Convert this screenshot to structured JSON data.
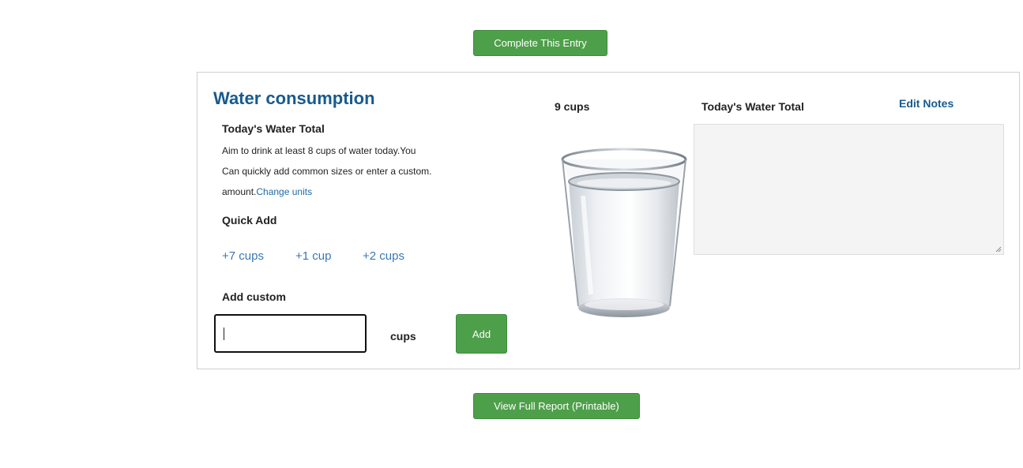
{
  "actions": {
    "complete_label": "Complete This Entry",
    "report_label": "View Full Report (Printable)"
  },
  "panel": {
    "title": "Water consumption",
    "left_subhead": "Today's Water Total",
    "desc_line1": "Aim to drink at least 8 cups of water today.You",
    "desc_line2": "Can quickly add common sizes or enter a custom.",
    "desc_line3_prefix": "amount.",
    "change_units_link": "Change units",
    "quick_add_heading": "Quick Add",
    "quick_add": [
      "+7 cups",
      "+1 cup",
      "+2 cups"
    ],
    "custom_heading": "Add custom",
    "custom_value": "",
    "custom_unit": "cups",
    "add_label": "Add",
    "total_cups": "9 cups",
    "right_subhead": "Today's Water Total",
    "edit_notes_label": "Edit Notes",
    "notes_value": ""
  },
  "icons": {
    "glass": "water-glass-image"
  },
  "colors": {
    "accent_green": "#4e9f4a",
    "title_blue": "#185a8e",
    "link_blue": "#1e6aa8"
  }
}
